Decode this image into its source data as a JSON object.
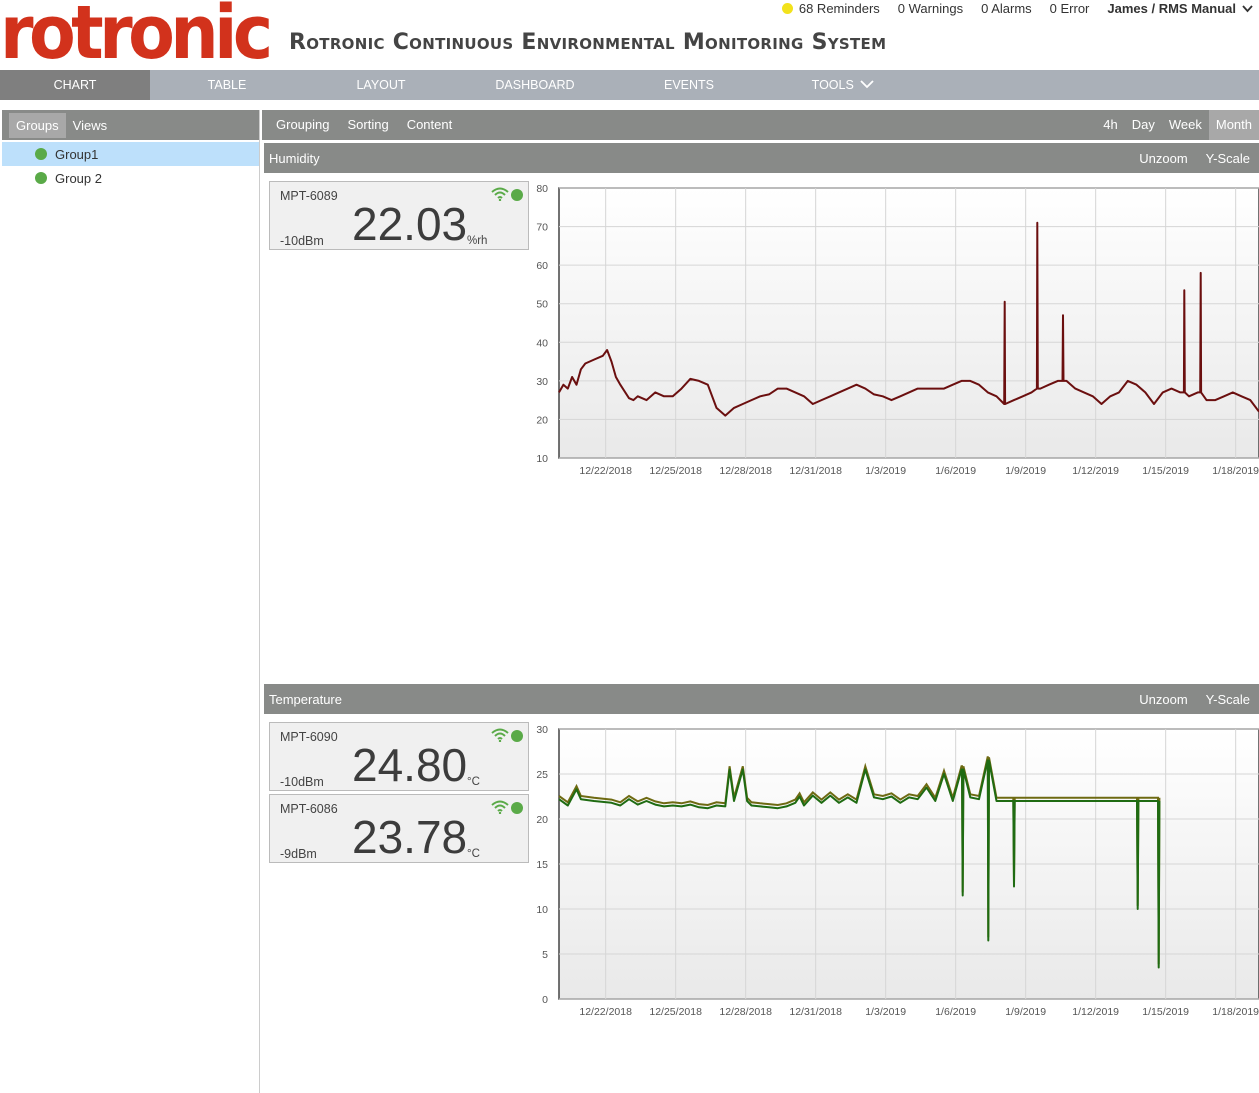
{
  "app": {
    "logo": "rotronic",
    "title": "Rotronic Continuous Environmental Monitoring System"
  },
  "status": {
    "reminders": "68 Reminders",
    "warnings": "0 Warnings",
    "alarms": "0 Alarms",
    "errors": "0 Error",
    "user": "James / RMS Manual"
  },
  "nav": [
    "CHART",
    "TABLE",
    "LAYOUT",
    "DASHBOARD",
    "EVENTS",
    "TOOLS"
  ],
  "sidebar": {
    "tabs": [
      "Groups",
      "Views"
    ],
    "groups": [
      "Group1",
      "Group 2"
    ]
  },
  "toolbar": {
    "tabs": [
      "Grouping",
      "Sorting",
      "Content"
    ],
    "ranges": [
      "4h",
      "Day",
      "Week",
      "Month"
    ]
  },
  "panel_actions": {
    "unzoom": "Unzoom",
    "yscale": "Y-Scale"
  },
  "humidity": {
    "title": "Humidity",
    "sensors": [
      {
        "name": "MPT-6089",
        "signal": "-10dBm",
        "value": "22.03",
        "unit": "%rh"
      }
    ]
  },
  "temperature": {
    "title": "Temperature",
    "sensors": [
      {
        "name": "MPT-6090",
        "signal": "-10dBm",
        "value": "24.80",
        "unit": "°C"
      },
      {
        "name": "MPT-6086",
        "signal": "-9dBm",
        "value": "23.78",
        "unit": "°C"
      }
    ]
  },
  "colors": {
    "brand": "#d2321c",
    "humidity_line": "#6b0f0f",
    "temperature_line": "#1f6b12",
    "temperature_line2": "#6e6a12",
    "status_ok": "#5aaa48"
  },
  "chart_data": [
    {
      "type": "line",
      "name": "humidity",
      "x_ticks": [
        "12/22/2018",
        "12/25/2018",
        "12/28/2018",
        "12/31/2018",
        "1/3/2019",
        "1/6/2019",
        "1/9/2019",
        "1/12/2019",
        "1/15/2019",
        "1/18/2019"
      ],
      "y_ticks": [
        10,
        20,
        30,
        40,
        50,
        60,
        70,
        80
      ],
      "ylim": [
        10,
        80
      ],
      "x_start": "12/20/2018",
      "x_end": "1/19/2019",
      "grid": true,
      "series": [
        {
          "points": [
            [
              0,
              27
            ],
            [
              0.5,
              29
            ],
            [
              1,
              28
            ],
            [
              1.5,
              31
            ],
            [
              2,
              29
            ],
            [
              2.5,
              33
            ],
            [
              3,
              34.5
            ],
            [
              4,
              35.5
            ],
            [
              5,
              36.5
            ],
            [
              5.5,
              38
            ],
            [
              6,
              35
            ],
            [
              6.5,
              31
            ],
            [
              7,
              29
            ],
            [
              8,
              25.5
            ],
            [
              8.5,
              25
            ],
            [
              9,
              26
            ],
            [
              10,
              25
            ],
            [
              10.5,
              26
            ],
            [
              11,
              27
            ],
            [
              12,
              26
            ],
            [
              13,
              26
            ],
            [
              14,
              28
            ],
            [
              15,
              30.5
            ],
            [
              16,
              30
            ],
            [
              17,
              29
            ],
            [
              18,
              23
            ],
            [
              19,
              21
            ],
            [
              20,
              23
            ],
            [
              21,
              24
            ],
            [
              22,
              25
            ],
            [
              23,
              26
            ],
            [
              24,
              26.5
            ],
            [
              25,
              28
            ],
            [
              26,
              28
            ],
            [
              27,
              27
            ],
            [
              28,
              26
            ],
            [
              29,
              24
            ],
            [
              30,
              25
            ],
            [
              31,
              26
            ],
            [
              32,
              27
            ],
            [
              33,
              28
            ],
            [
              34,
              29
            ],
            [
              35,
              28
            ],
            [
              36,
              26.5
            ],
            [
              37,
              26
            ],
            [
              38,
              25
            ],
            [
              39,
              26
            ],
            [
              40,
              27
            ],
            [
              41,
              28
            ],
            [
              42,
              28
            ],
            [
              43,
              28
            ],
            [
              44,
              28
            ],
            [
              45,
              29
            ],
            [
              46,
              30
            ],
            [
              47,
              30
            ],
            [
              48,
              29
            ],
            [
              49,
              27
            ],
            [
              50,
              26
            ],
            [
              51,
              24
            ],
            [
              52,
              25
            ],
            [
              53,
              26
            ],
            [
              54,
              27
            ],
            [
              55,
              28
            ],
            [
              56,
              29
            ],
            [
              57,
              30
            ],
            [
              58,
              30
            ],
            [
              59,
              28
            ],
            [
              60,
              27
            ],
            [
              61,
              26
            ],
            [
              62,
              24
            ],
            [
              63,
              26
            ],
            [
              64,
              27
            ],
            [
              65,
              30
            ],
            [
              66,
              29
            ],
            [
              67,
              27
            ],
            [
              68,
              24
            ],
            [
              69,
              27
            ],
            [
              70,
              28
            ],
            [
              71,
              27
            ],
            [
              72,
              26
            ],
            [
              73,
              27
            ],
            [
              74,
              25
            ],
            [
              75,
              25
            ],
            [
              76,
              26
            ],
            [
              77,
              27
            ],
            [
              78,
              26
            ],
            [
              79,
              25
            ],
            [
              80,
              22
            ]
          ],
          "spikes": [
            [
              19.1,
              50.5
            ],
            [
              20.5,
              71
            ],
            [
              21.6,
              47
            ],
            [
              26.8,
              53.5
            ],
            [
              27.5,
              58
            ]
          ]
        }
      ]
    },
    {
      "type": "line",
      "name": "temperature",
      "x_ticks": [
        "12/22/2018",
        "12/25/2018",
        "12/28/2018",
        "12/31/2018",
        "1/3/2019",
        "1/6/2019",
        "1/9/2019",
        "1/12/2019",
        "1/15/2019",
        "1/18/2019"
      ],
      "y_ticks": [
        0,
        5,
        10,
        15,
        20,
        25,
        30
      ],
      "ylim": [
        0,
        30
      ],
      "x_start": "12/20/2018",
      "x_end": "1/19/2019",
      "grid": true,
      "series": [
        {
          "base": 22,
          "points": [
            [
              0,
              22.2
            ],
            [
              1,
              21.5
            ],
            [
              2,
              23.3
            ],
            [
              2.5,
              22.2
            ],
            [
              4,
              22
            ],
            [
              6,
              21.8
            ],
            [
              7,
              21.5
            ],
            [
              8,
              22.2
            ],
            [
              9,
              21.6
            ],
            [
              10,
              22
            ],
            [
              11,
              21.6
            ],
            [
              12,
              21.4
            ],
            [
              13,
              21.5
            ],
            [
              14,
              21.4
            ],
            [
              15,
              21.6
            ],
            [
              16,
              21.3
            ],
            [
              17,
              21.2
            ],
            [
              18,
              21.5
            ],
            [
              19,
              21.4
            ],
            [
              19.5,
              25.5
            ],
            [
              20,
              22
            ],
            [
              21,
              25.5
            ],
            [
              21.5,
              22
            ],
            [
              22,
              21.5
            ],
            [
              23,
              21.4
            ],
            [
              24,
              21.3
            ],
            [
              25,
              21.2
            ],
            [
              26,
              21.4
            ],
            [
              27,
              21.8
            ],
            [
              27.5,
              22.5
            ],
            [
              28,
              21.5
            ],
            [
              29,
              22.6
            ],
            [
              30,
              21.8
            ],
            [
              31,
              22.6
            ],
            [
              32,
              21.8
            ],
            [
              33,
              22.4
            ],
            [
              34,
              21.8
            ],
            [
              35,
              25.5
            ],
            [
              36,
              22.4
            ],
            [
              37,
              22.2
            ],
            [
              38,
              22.5
            ],
            [
              39,
              21.8
            ],
            [
              40,
              22.4
            ],
            [
              41,
              22.2
            ],
            [
              42,
              23.5
            ],
            [
              43,
              22
            ],
            [
              44,
              25
            ],
            [
              45,
              22
            ],
            [
              46,
              25.5
            ],
            [
              47,
              22.4
            ],
            [
              48,
              22.2
            ],
            [
              49,
              26.5
            ],
            [
              50,
              22
            ]
          ]
        }
      ],
      "spikes_down": [
        [
          17.3,
          11.5
        ],
        [
          18.4,
          6.5
        ],
        [
          19.5,
          12.5
        ],
        [
          24.8,
          10
        ],
        [
          25.7,
          3.5
        ]
      ]
    }
  ]
}
